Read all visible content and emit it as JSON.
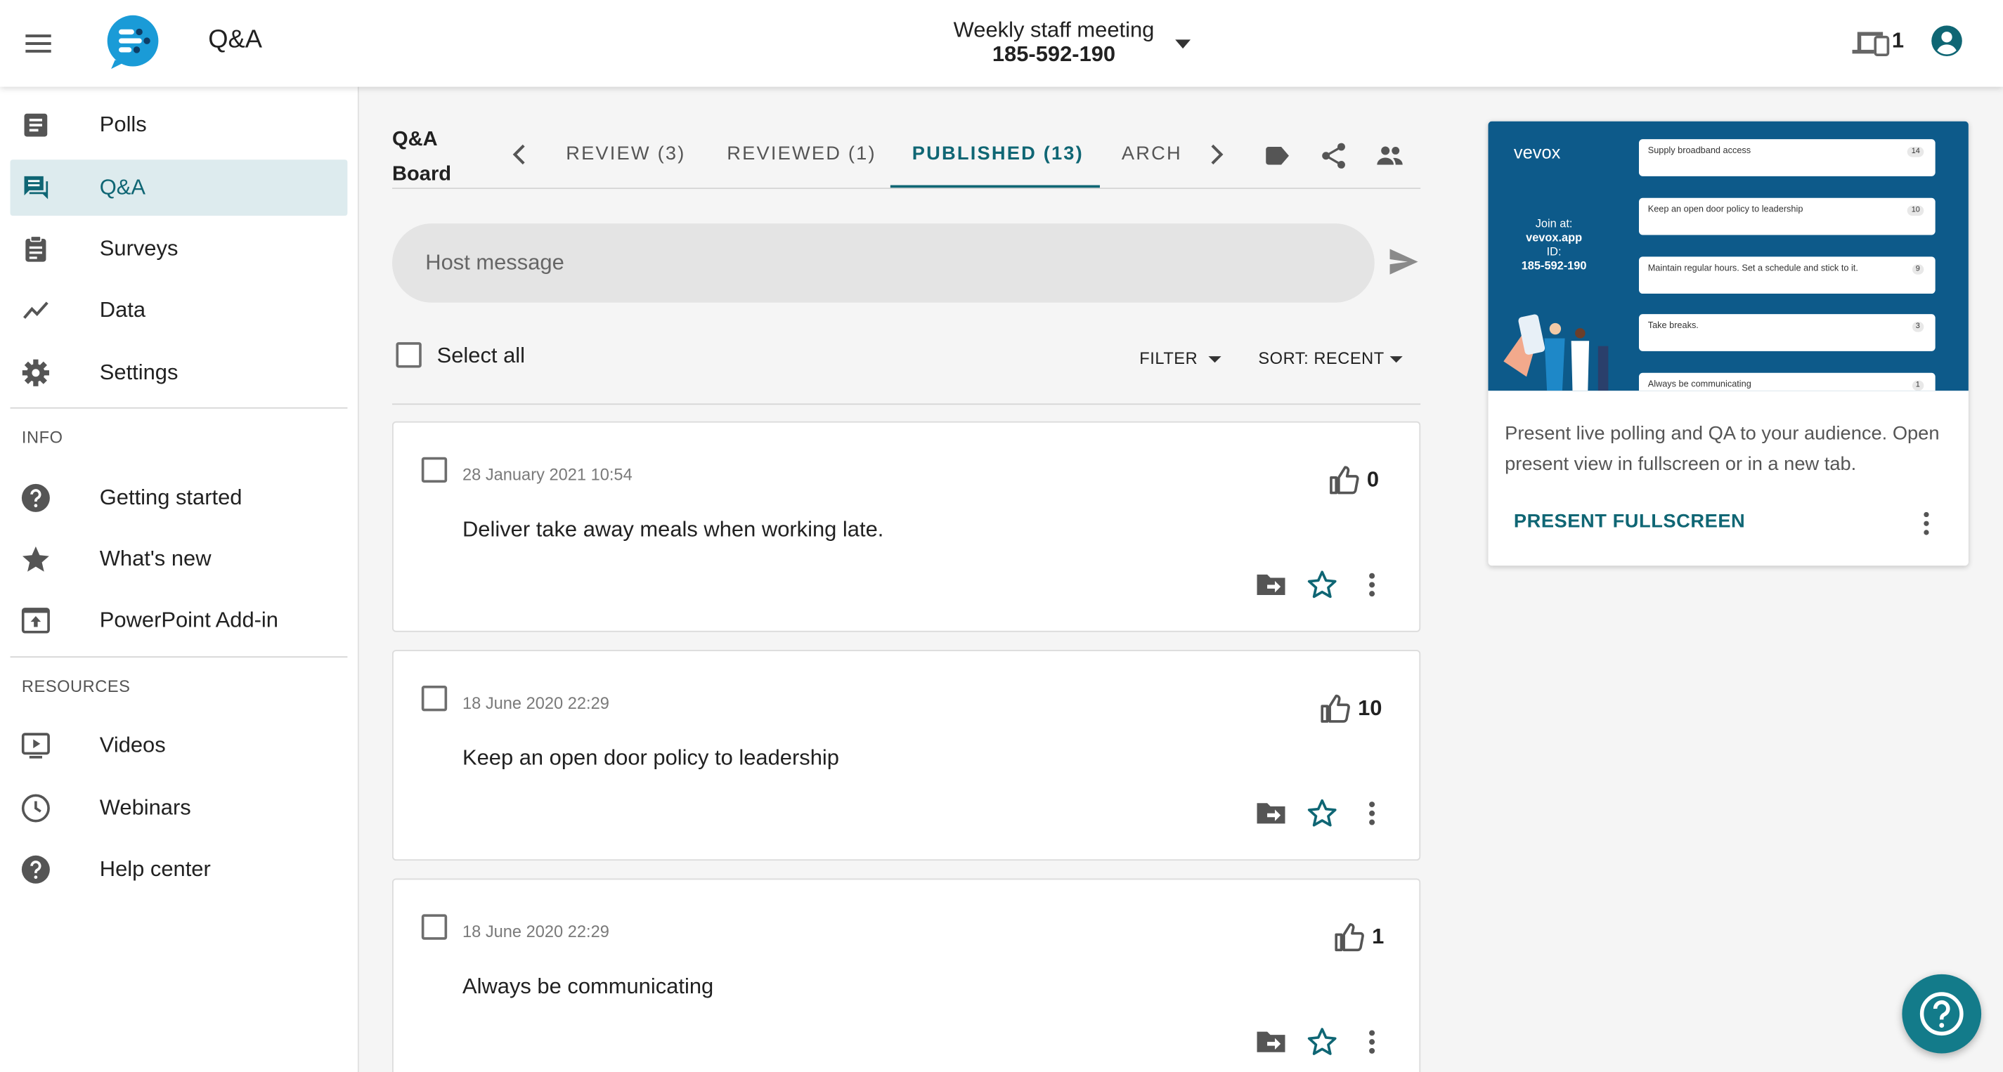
{
  "header": {
    "app_title": "Q&A",
    "meeting_name": "Weekly staff meeting",
    "meeting_id": "185-592-190",
    "device_count": "1"
  },
  "sidebar": {
    "main_items": [
      {
        "label": "Polls",
        "icon": "polls-icon"
      },
      {
        "label": "Q&A",
        "icon": "qa-icon",
        "active": true
      },
      {
        "label": "Surveys",
        "icon": "surveys-icon"
      },
      {
        "label": "Data",
        "icon": "data-icon"
      },
      {
        "label": "Settings",
        "icon": "gear-icon"
      }
    ],
    "info_heading": "INFO",
    "info_items": [
      {
        "label": "Getting started",
        "icon": "help-icon"
      },
      {
        "label": "What's new",
        "icon": "star-icon"
      },
      {
        "label": "PowerPoint Add-in",
        "icon": "upload-icon"
      }
    ],
    "resources_heading": "RESOURCES",
    "resource_items": [
      {
        "label": "Videos",
        "icon": "video-icon"
      },
      {
        "label": "Webinars",
        "icon": "clock-icon"
      },
      {
        "label": "Help center",
        "icon": "help-icon"
      }
    ]
  },
  "board": {
    "title": "Q&A Board",
    "tabs": [
      {
        "label": "REVIEW (3)"
      },
      {
        "label": "REVIEWED (1)"
      },
      {
        "label": "PUBLISHED (13)",
        "active": true
      },
      {
        "label": "ARCH"
      }
    ],
    "host_placeholder": "Host message",
    "select_all": "Select all",
    "filter": "FILTER",
    "sort": "SORT: RECENT"
  },
  "questions": [
    {
      "date": "28 January 2021 10:54",
      "text": "Deliver take away meals when working late.",
      "likes": "0"
    },
    {
      "date": "18 June 2020 22:29",
      "text": "Keep an open door policy to leadership",
      "likes": "10"
    },
    {
      "date": "18 June 2020 22:29",
      "text": "Always be communicating",
      "likes": "1"
    }
  ],
  "present": {
    "preview": {
      "logo": "vevox",
      "join_at": "Join at:",
      "join_url": "vevox.app",
      "id_label": "ID:",
      "id": "185-592-190",
      "bubbles": [
        {
          "text": "Supply broadband access",
          "votes": "14"
        },
        {
          "text": "Keep an open door policy to leadership",
          "votes": "10"
        },
        {
          "text": "Maintain regular hours. Set a schedule and stick to it.",
          "votes": "9"
        },
        {
          "text": "Take breaks.",
          "votes": "3"
        },
        {
          "text": "Always be communicating",
          "votes": "1"
        }
      ]
    },
    "description": "Present live polling and QA to your audience. Open present view in fullscreen or in a new tab.",
    "button": "PRESENT FULLSCREEN"
  },
  "colors": {
    "accent": "#0f6674",
    "active_nav_bg": "#ddebee",
    "preview_bg": "#0d5a8a",
    "help_fab": "#137b8a"
  }
}
